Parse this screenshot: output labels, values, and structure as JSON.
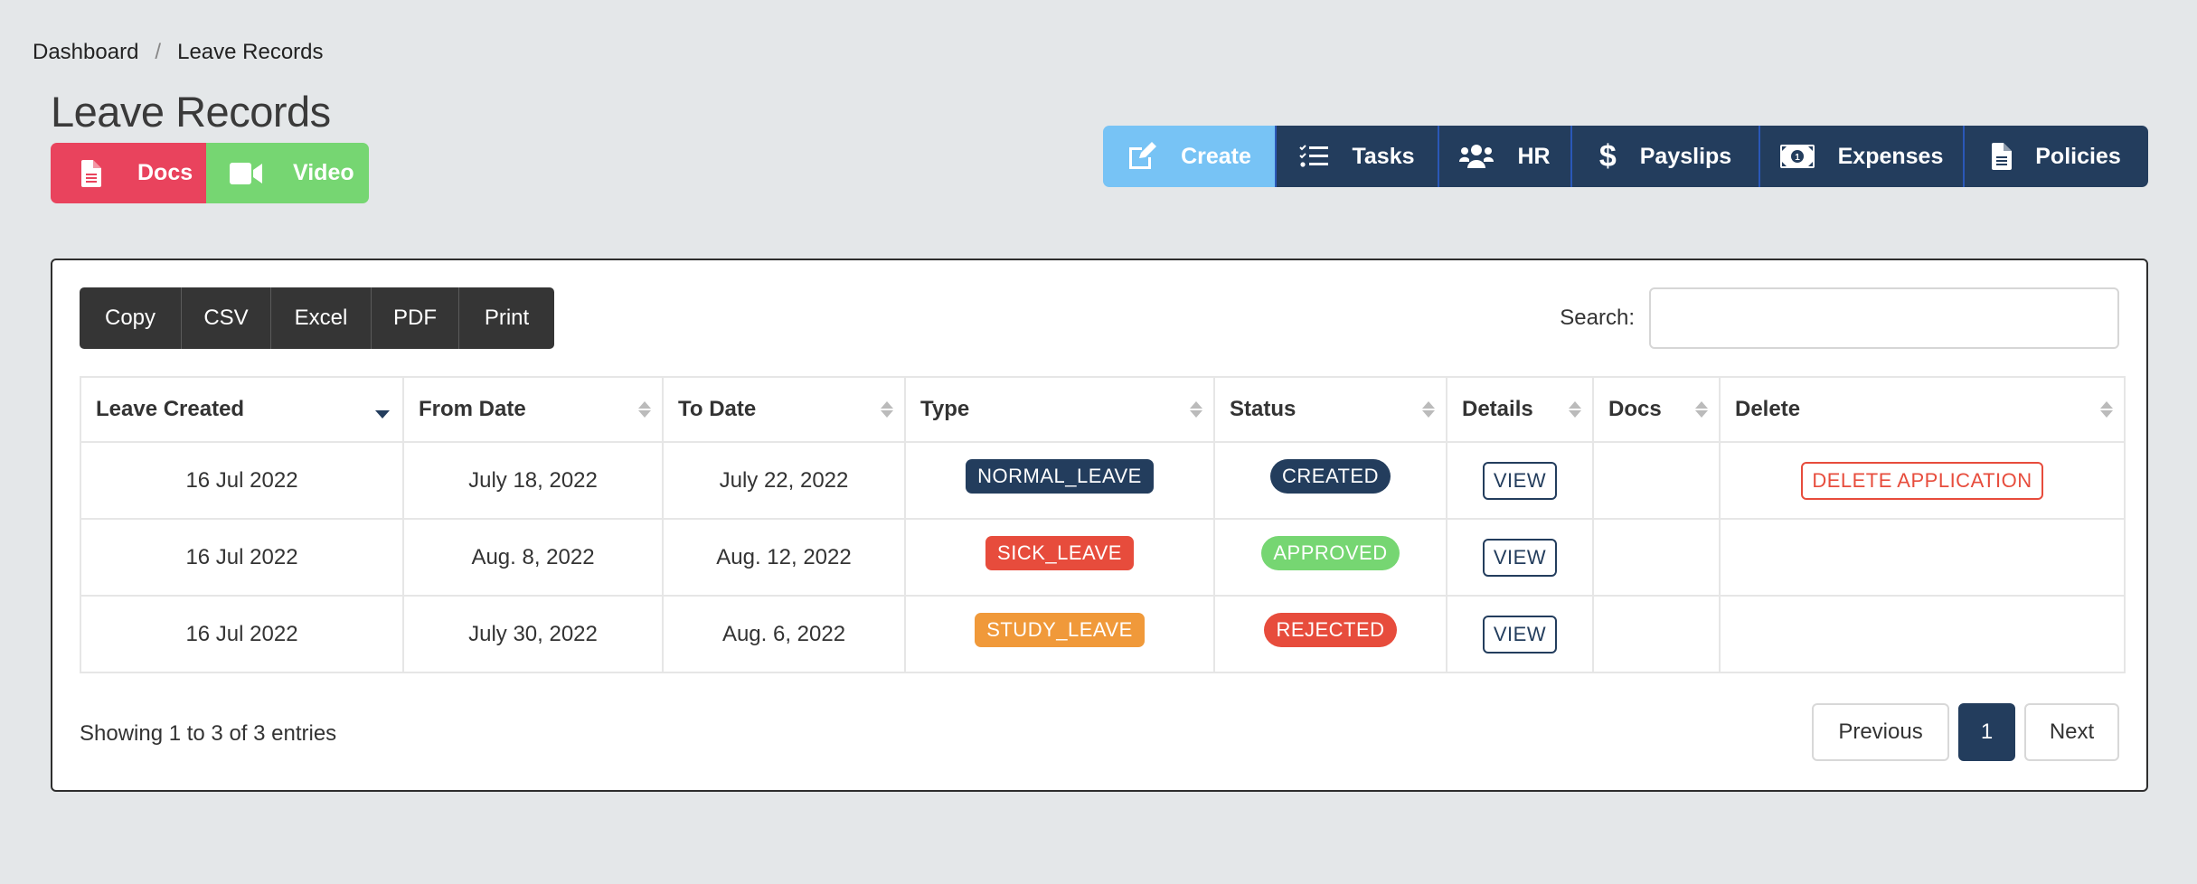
{
  "breadcrumb": {
    "items": [
      "Dashboard",
      "Leave Records"
    ],
    "separator": "/"
  },
  "page": {
    "title": "Leave Records"
  },
  "media_buttons": [
    {
      "label": "Docs",
      "icon": "file-icon",
      "color": "#e9435d"
    },
    {
      "label": "Video",
      "icon": "video-camera-icon",
      "color": "#76d672"
    }
  ],
  "topnav": [
    {
      "label": "Create",
      "icon": "edit-icon",
      "active": true,
      "color": "#77c3f5"
    },
    {
      "label": "Tasks",
      "icon": "tasks-icon"
    },
    {
      "label": "HR",
      "icon": "users-icon"
    },
    {
      "label": "Payslips",
      "icon": "dollar-icon"
    },
    {
      "label": "Expenses",
      "icon": "money-bill-icon"
    },
    {
      "label": "Policies",
      "icon": "file-alt-icon"
    }
  ],
  "export_buttons": [
    "Copy",
    "CSV",
    "Excel",
    "PDF",
    "Print"
  ],
  "search": {
    "label": "Search:",
    "value": "",
    "placeholder": ""
  },
  "table": {
    "columns": [
      "Leave Created",
      "From Date",
      "To Date",
      "Type",
      "Status",
      "Details",
      "Docs",
      "Delete"
    ],
    "sorted_column": "Leave Created",
    "sort_direction": "desc",
    "rows": [
      {
        "created": "16 Jul 2022",
        "from": "July 18, 2022",
        "to": "July 22, 2022",
        "type": "NORMAL_LEAVE",
        "type_color": "#233d5d",
        "status": "CREATED",
        "status_color": "#233d5d",
        "details": "VIEW",
        "docs": "",
        "delete": "DELETE APPLICATION"
      },
      {
        "created": "16 Jul 2022",
        "from": "Aug. 8, 2022",
        "to": "Aug. 12, 2022",
        "type": "SICK_LEAVE",
        "type_color": "#e74c3c",
        "status": "APPROVED",
        "status_color": "#76d672",
        "details": "VIEW",
        "docs": "",
        "delete": ""
      },
      {
        "created": "16 Jul 2022",
        "from": "July 30, 2022",
        "to": "Aug. 6, 2022",
        "type": "STUDY_LEAVE",
        "type_color": "#f0993a",
        "status": "REJECTED",
        "status_color": "#e74c3c",
        "details": "VIEW",
        "docs": "",
        "delete": ""
      }
    ]
  },
  "footer": {
    "info": "Showing 1 to 3 of 3 entries",
    "pagination": {
      "previous": "Previous",
      "current": "1",
      "next": "Next"
    }
  },
  "colors": {
    "primary": "#233d5d",
    "danger": "#e74c3c",
    "success": "#76d672",
    "warning": "#f0993a",
    "info": "#77c3f5"
  }
}
